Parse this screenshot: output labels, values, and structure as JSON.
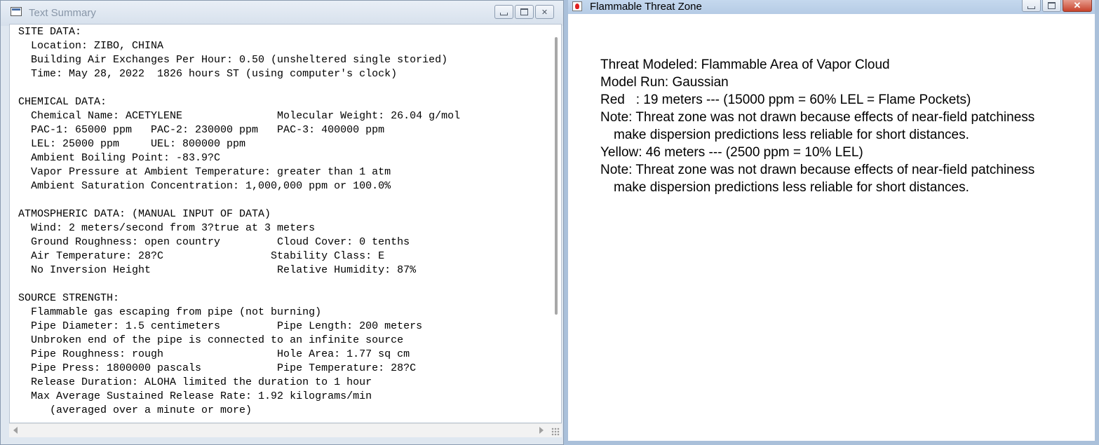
{
  "left_window": {
    "title": "Text Summary",
    "controls": {
      "minimize": "minimize",
      "maximize": "maximize",
      "close": "✕"
    },
    "summary_text": "SITE DATA:\n  Location: ZIBO, CHINA\n  Building Air Exchanges Per Hour: 0.50 (unsheltered single storied)\n  Time: May 28, 2022  1826 hours ST (using computer's clock)\n\nCHEMICAL DATA:\n  Chemical Name: ACETYLENE               Molecular Weight: 26.04 g/mol\n  PAC-1: 65000 ppm   PAC-2: 230000 ppm   PAC-3: 400000 ppm\n  LEL: 25000 ppm     UEL: 800000 ppm\n  Ambient Boiling Point: -83.9?C\n  Vapor Pressure at Ambient Temperature: greater than 1 atm\n  Ambient Saturation Concentration: 1,000,000 ppm or 100.0%\n\nATMOSPHERIC DATA: (MANUAL INPUT OF DATA)\n  Wind: 2 meters/second from 3?true at 3 meters\n  Ground Roughness: open country         Cloud Cover: 0 tenths\n  Air Temperature: 28?C                 Stability Class: E\n  No Inversion Height                    Relative Humidity: 87%\n\nSOURCE STRENGTH:\n  Flammable gas escaping from pipe (not burning)\n  Pipe Diameter: 1.5 centimeters         Pipe Length: 200 meters\n  Unbroken end of the pipe is connected to an infinite source\n  Pipe Roughness: rough                  Hole Area: 1.77 sq cm\n  Pipe Press: 1800000 pascals            Pipe Temperature: 28?C\n  Release Duration: ALOHA limited the duration to 1 hour\n  Max Average Sustained Release Rate: 1.92 kilograms/min\n     (averaged over a minute or more)"
  },
  "right_window": {
    "title": "Flammable Threat Zone",
    "controls": {
      "minimize": "minimize",
      "maximize": "maximize",
      "close": "✕"
    },
    "lines": [
      "Threat Modeled: Flammable Area of Vapor Cloud",
      "Model Run: Gaussian",
      "Red   : 19 meters --- (15000 ppm = 60% LEL = Flame Pockets)",
      "Note: Threat zone was not drawn because effects of near-field patchiness",
      "make dispersion predictions less reliable for short distances.",
      "Yellow: 46 meters --- (2500 ppm = 10% LEL)",
      "Note: Threat zone was not drawn because effects of near-field patchiness",
      "make dispersion predictions less reliable for short distances."
    ]
  }
}
